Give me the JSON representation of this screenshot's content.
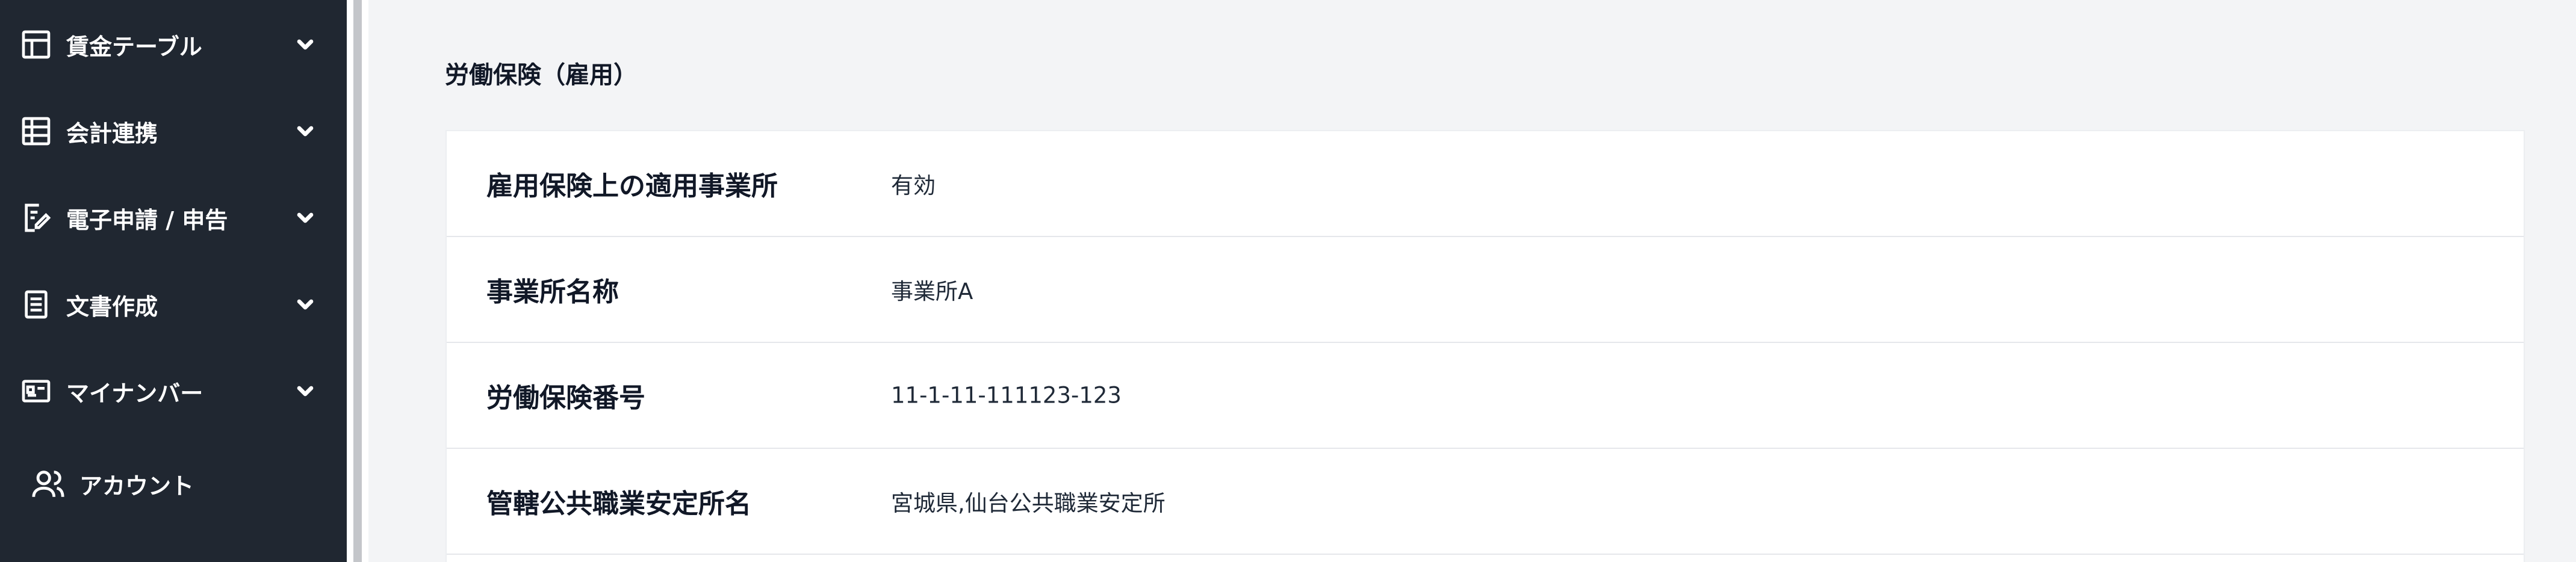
{
  "sidebar": {
    "items": [
      {
        "label": "賃金テーブル",
        "icon": "table-icon",
        "expandable": true
      },
      {
        "label": "会計連携",
        "icon": "spreadsheet-icon",
        "expandable": true
      },
      {
        "label": "電子申請 / 申告",
        "icon": "document-edit-icon",
        "expandable": true
      },
      {
        "label": "文書作成",
        "icon": "document-text-icon",
        "expandable": true
      },
      {
        "label": "マイナンバー",
        "icon": "id-card-icon",
        "expandable": true
      },
      {
        "label": "アカウント",
        "icon": "users-icon",
        "expandable": false
      }
    ]
  },
  "main": {
    "section_title": "労働保険（雇用）",
    "rows": [
      {
        "label": "雇用保険上の適用事業所",
        "value": "有効"
      },
      {
        "label": "事業所名称",
        "value": "事業所A"
      },
      {
        "label": "労働保険番号",
        "value": "11-1-11-111123-123"
      },
      {
        "label": "管轄公共職業安定所名",
        "value": "宮城県,仙台公共職業安定所"
      }
    ]
  },
  "colors": {
    "sidebar_bg": "#202731",
    "main_bg": "#f3f4f6",
    "card_bg": "#ffffff",
    "divider": "#e5e7eb"
  }
}
